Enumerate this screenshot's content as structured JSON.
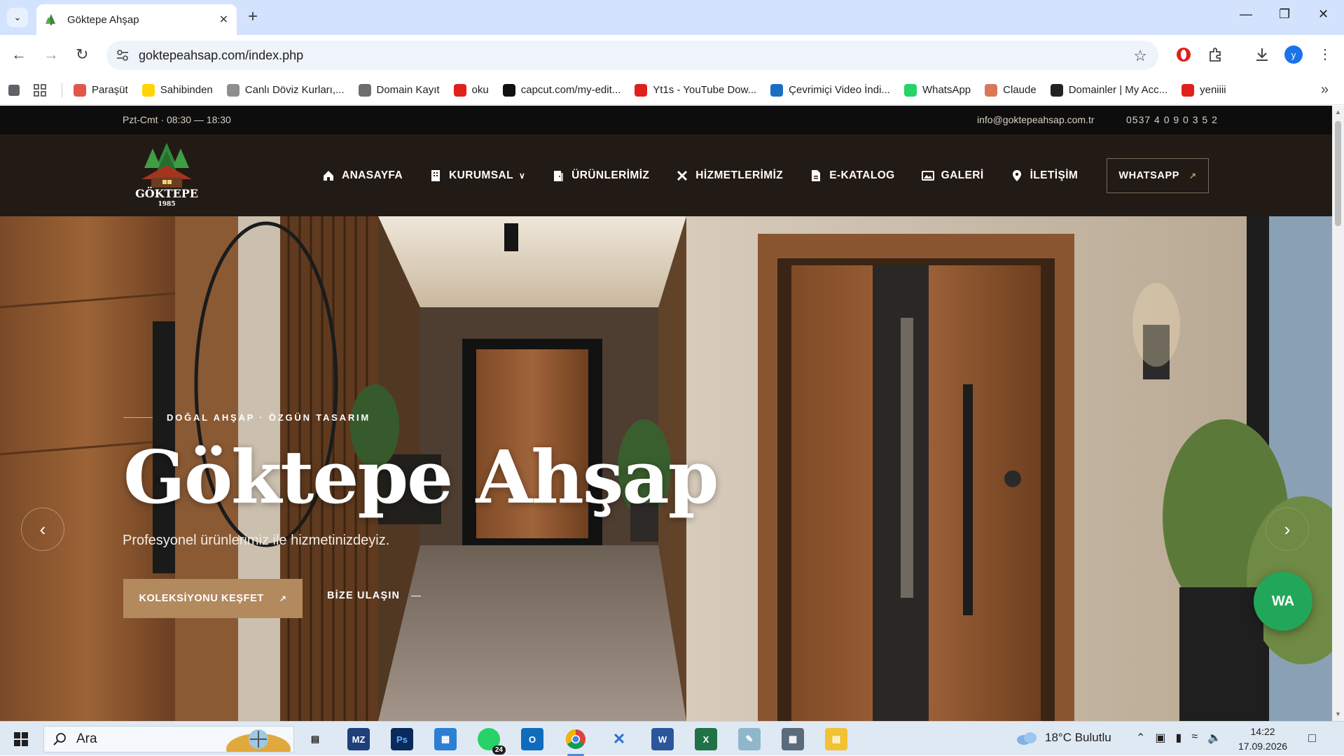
{
  "browser": {
    "tab_title": "Göktepe Ahşap",
    "url": "goktepeahsap.com/index.php",
    "profile_initial": "y",
    "bookmarks": [
      {
        "label": "Paraşüt",
        "color": "#e2574c"
      },
      {
        "label": "Sahibinden",
        "color": "#ffd400"
      },
      {
        "label": "Canlı Döviz Kurları,...",
        "color": "#8e8e8e"
      },
      {
        "label": "Domain Kayıt",
        "color": "#6d6d6d"
      },
      {
        "label": "oku",
        "color": "#e0201b"
      },
      {
        "label": "capcut.com/my-edit...",
        "color": "#111111"
      },
      {
        "label": "Yt1s - YouTube Dow...",
        "color": "#e0201b"
      },
      {
        "label": "Çevrimiçi Video İndi...",
        "color": "#1b6fc2"
      },
      {
        "label": "WhatsApp",
        "color": "#25d366"
      },
      {
        "label": "Claude",
        "color": "#d97757"
      },
      {
        "label": "Domainler | My Acc...",
        "color": "#222222"
      },
      {
        "label": "yeniiii",
        "color": "#e0201b"
      }
    ]
  },
  "site": {
    "topbar": {
      "hours": "Pzt-Cmt · 08:30 — 18:30",
      "email": "info@goktepeahsap.com.tr",
      "phone": "0537 4 0 9 0 3 5 2"
    },
    "logo": {
      "name": "GÖKTEPE",
      "year": "1985"
    },
    "nav": [
      {
        "label": "ANASAYFA",
        "icon": "home-icon"
      },
      {
        "label": "KURUMSAL",
        "icon": "building-icon",
        "dropdown": true
      },
      {
        "label": "ÜRÜNLERİMİZ",
        "icon": "door-icon"
      },
      {
        "label": "HİZMETLERİMİZ",
        "icon": "tools-icon"
      },
      {
        "label": "E-KATALOG",
        "icon": "file-icon"
      },
      {
        "label": "GALERİ",
        "icon": "image-icon"
      },
      {
        "label": "İLETİŞİM",
        "icon": "map-pin-icon"
      }
    ],
    "whatsapp_button": "WHATSAPP",
    "hero": {
      "kicker": "DOĞAL AHŞAP · ÖZGÜN TASARIM",
      "title": "Göktepe Ahşap",
      "subtitle": "Profesyonel ürünlerimiz ile hizmetinizdeyiz.",
      "primary_cta": "KOLEKSİYONU KEŞFET",
      "secondary_cta": "BİZE ULAŞIN"
    },
    "whatsapp_float": "WA"
  },
  "taskbar": {
    "search_placeholder": "Ara",
    "weather": "18°C Bulutlu",
    "time": "14:22",
    "date": "17.09.2026",
    "badge": "24"
  }
}
